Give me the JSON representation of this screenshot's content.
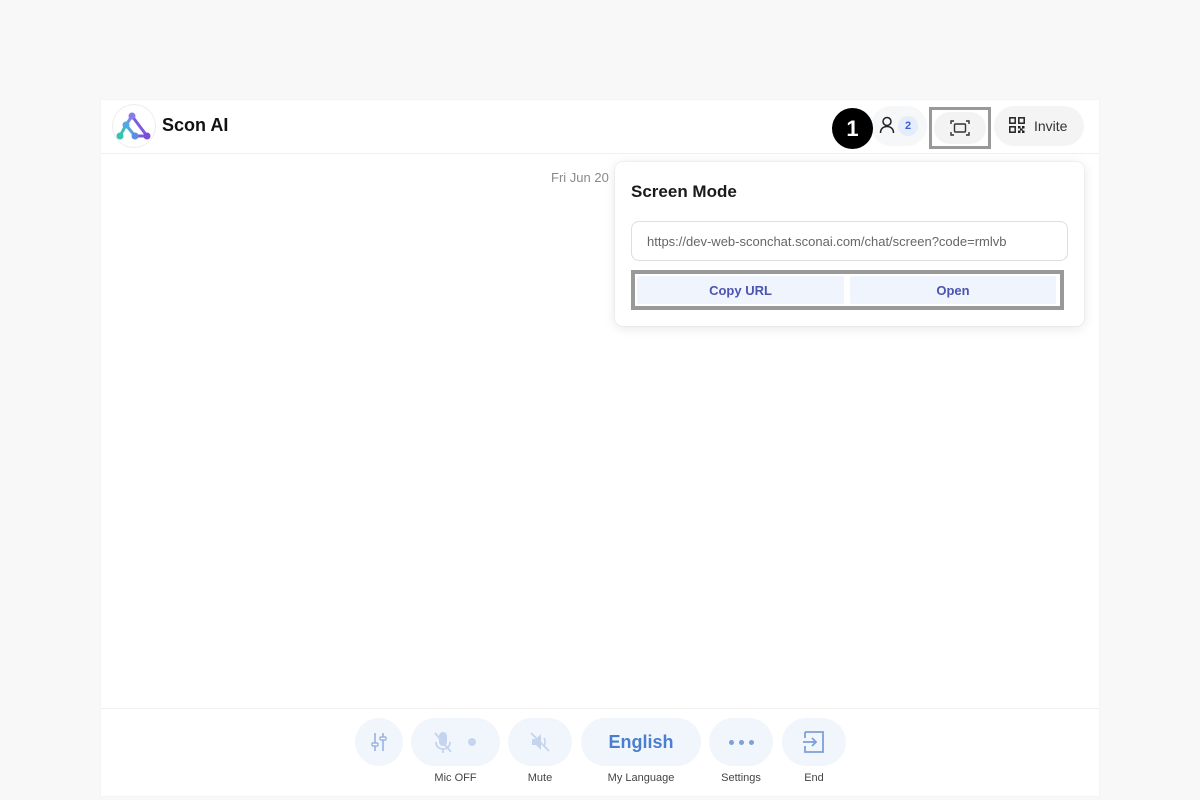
{
  "header": {
    "app_title": "Scon AI",
    "step_badge": "1",
    "participant_count": "2",
    "invite_label": "Invite"
  },
  "chat": {
    "date_label": "Fri Jun 20"
  },
  "screen_mode": {
    "title": "Screen Mode",
    "url_value": "https://dev-web-sconchat.sconai.com/chat/screen?code=rmlvb",
    "copy_label": "Copy URL",
    "open_label": "Open"
  },
  "footer": {
    "mic_label": "Mic OFF",
    "mute_label": "Mute",
    "language_value": "English",
    "language_label": "My Language",
    "settings_label": "Settings",
    "end_label": "End"
  },
  "colors": {
    "accent_blue": "#4a7fd0",
    "button_bg": "#f1f6fc",
    "link_text": "#4b54b0",
    "highlight_border": "#999999"
  },
  "icons": [
    "app-logo-icon",
    "user-icon",
    "screen-mode-icon",
    "qr-code-icon",
    "equalizer-icon",
    "mic-off-icon",
    "speaker-mute-icon",
    "more-icon",
    "exit-icon"
  ]
}
